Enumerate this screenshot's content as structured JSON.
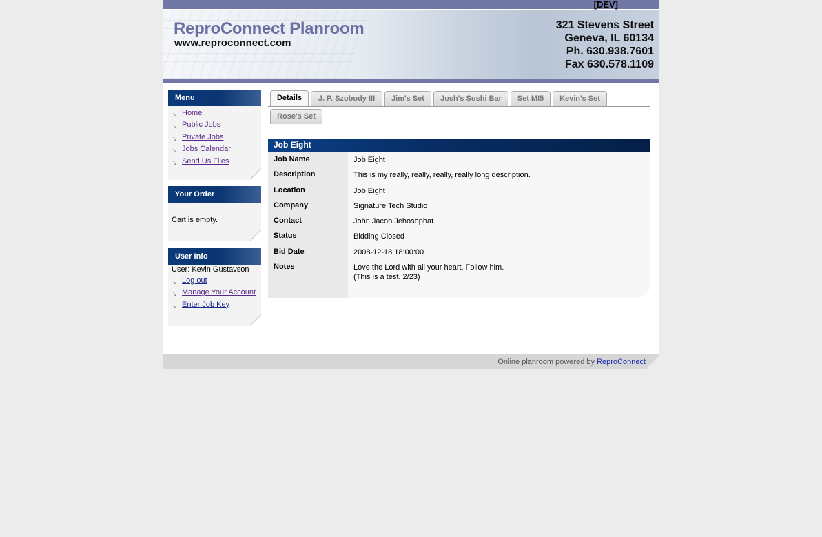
{
  "header": {
    "dev_badge": "[DEV]",
    "brand_title": "ReproConnect Planroom",
    "brand_url": "www.reproconnect.com",
    "address_lines": [
      "321 Stevens Street",
      "Geneva, IL 60134",
      "Ph. 630.938.7601",
      "Fax 630.578.1109"
    ]
  },
  "menu": {
    "title": "Menu",
    "items": [
      "Home",
      "Public Jobs",
      "Private Jobs",
      "Jobs Calendar",
      "Send Us Files"
    ]
  },
  "order": {
    "title": "Your Order",
    "text": "Cart is empty."
  },
  "user_info": {
    "title": "User Info",
    "user_line": "User: Kevin Gustavson",
    "links": [
      "Log out",
      "Manage Your Account",
      "Enter Job Key"
    ]
  },
  "tabs": [
    "Details",
    "J. P. Szobody III",
    "Jim's Set",
    "Josh's Sushi Bar",
    "Set MI5",
    "Kevin's Set",
    "Rose's Set"
  ],
  "active_tab": "Details",
  "job": {
    "title": "Job Eight",
    "fields": [
      {
        "label": "Job Name",
        "value": "Job Eight"
      },
      {
        "label": "Description",
        "value": "This is my really, really, really, really long description."
      },
      {
        "label": "Location",
        "value": "Job Eight"
      },
      {
        "label": "Company",
        "value": "Signature Tech Studio"
      },
      {
        "label": "Contact",
        "value": "John Jacob Jehosophat"
      },
      {
        "label": "Status",
        "value": "Bidding Closed"
      },
      {
        "label": "Bid Date",
        "value": "2008-12-18 18:00:00"
      },
      {
        "label": "Notes",
        "value": "Love the Lord with all your heart. Follow him.\n(This is a test. 2/23)"
      }
    ]
  },
  "footer": {
    "text": "Online planroom powered by",
    "link": "ReproConnect"
  }
}
